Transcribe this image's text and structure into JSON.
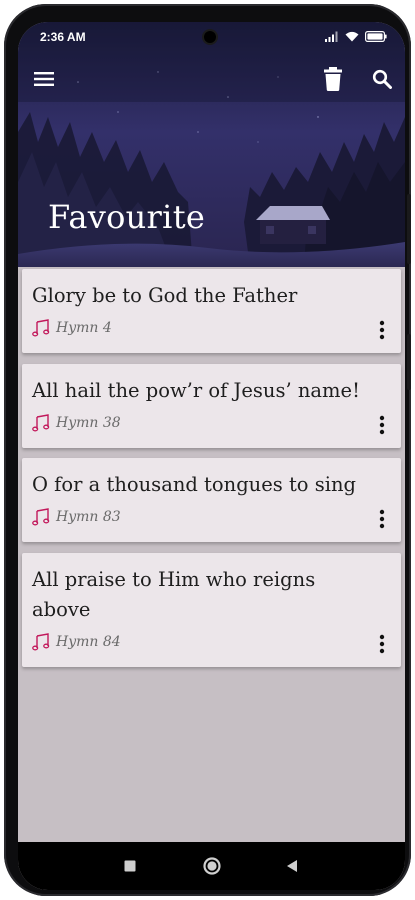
{
  "status_bar": {
    "time": "2:36 AM"
  },
  "app_bar": {
    "menu_icon": "hamburger-menu-icon",
    "delete_icon": "trash-icon",
    "search_icon": "search-icon",
    "title": "Favourite"
  },
  "favourites": [
    {
      "title": "Glory be to God the Father",
      "subtitle": "Hymn 4"
    },
    {
      "title": "All hail the pow’r of Jesus’ name!",
      "subtitle": "Hymn 38"
    },
    {
      "title": "O for a thousand tongues to sing",
      "subtitle": "Hymn 83"
    },
    {
      "title": "All praise to Him who reigns above",
      "subtitle": "Hymn 84"
    }
  ],
  "colors": {
    "accent": "#c2185b",
    "card_bg": "#ece6ea",
    "list_bg": "#c6bfc4",
    "header_sky": "#2c2a55"
  }
}
